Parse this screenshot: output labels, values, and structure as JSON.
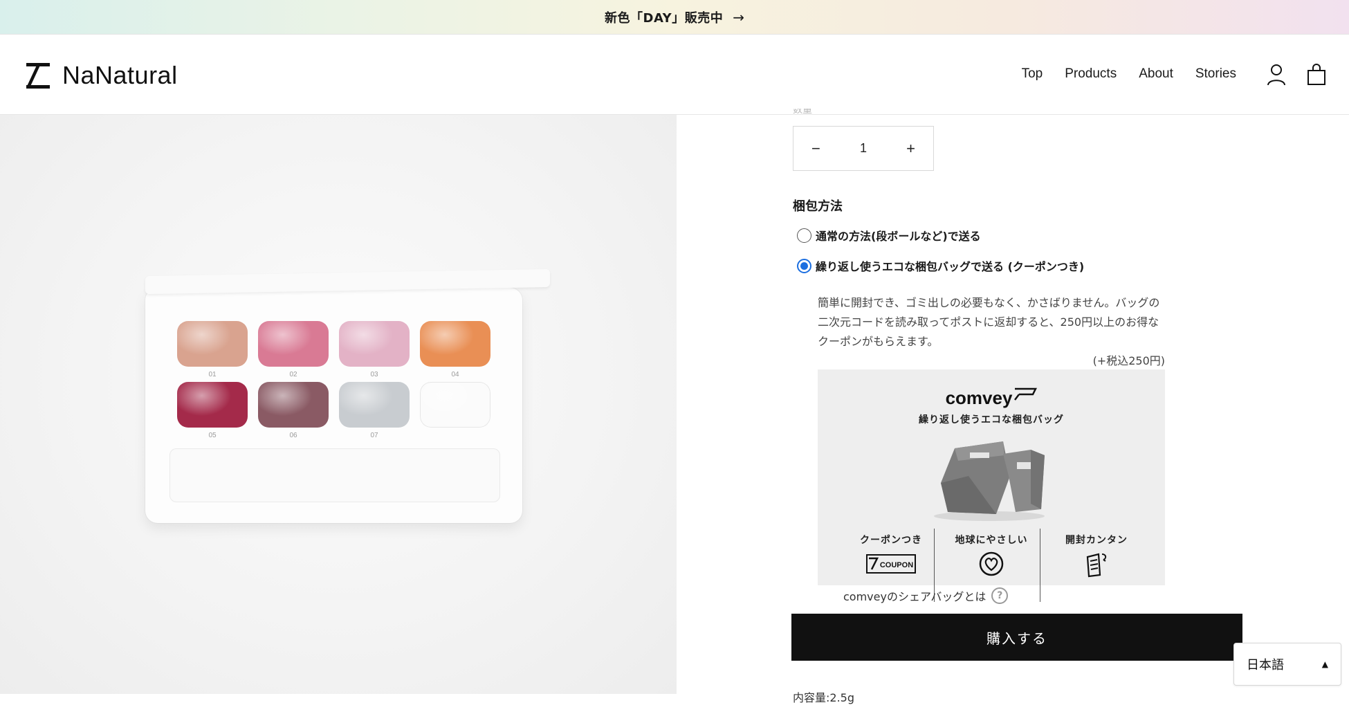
{
  "announcement": {
    "text": "新色「DAY」販売中",
    "arrow": "→"
  },
  "header": {
    "logo_text": "NaNatural",
    "nav": [
      "Top",
      "Products",
      "About",
      "Stories"
    ],
    "icons": [
      "account-icon",
      "cart-icon"
    ]
  },
  "gallery": {
    "pan_numbers": [
      "01",
      "02",
      "03",
      "04",
      "05",
      "06",
      "07"
    ],
    "pan_colors": [
      "#d9a38f",
      "#d97a94",
      "#e3b2c6",
      "#e98f55",
      "#a42a4a",
      "#8a5a64",
      "#c8ccd0",
      "#fbfbfb"
    ]
  },
  "quantity": {
    "minus": "−",
    "value": "1",
    "plus": "+"
  },
  "packing": {
    "title": "梱包方法",
    "options": [
      {
        "label": "通常の方法(段ボールなど)で送る",
        "checked": false
      },
      {
        "label": "繰り返し使うエコな梱包バッグで送る (クーポンつき)",
        "checked": true
      }
    ],
    "description": "簡単に開封でき、ゴミ出しの必要もなく、かさばりません。バッグの二次元コードを読み取ってポストに返却すると、250円以上のお得なクーポンがもらえます。",
    "price_note": "(+税込250円)"
  },
  "banner": {
    "brand": "comvey",
    "subtitle": "繰り返し使うエコな梱包バッグ",
    "features": [
      {
        "title": "クーポンつき",
        "icon": "coupon-icon",
        "icon_text": "COUPON"
      },
      {
        "title": "地球にやさしい",
        "icon": "globe-heart-icon"
      },
      {
        "title": "開封カンタン",
        "icon": "easy-open-icon"
      }
    ]
  },
  "comvey_link": {
    "text": "comveyのシェアバッグとは",
    "icon": "?"
  },
  "buy_button": "購入する",
  "cut_text": "内容量:2.5g",
  "language": {
    "label": "日本語",
    "caret": "▲"
  }
}
